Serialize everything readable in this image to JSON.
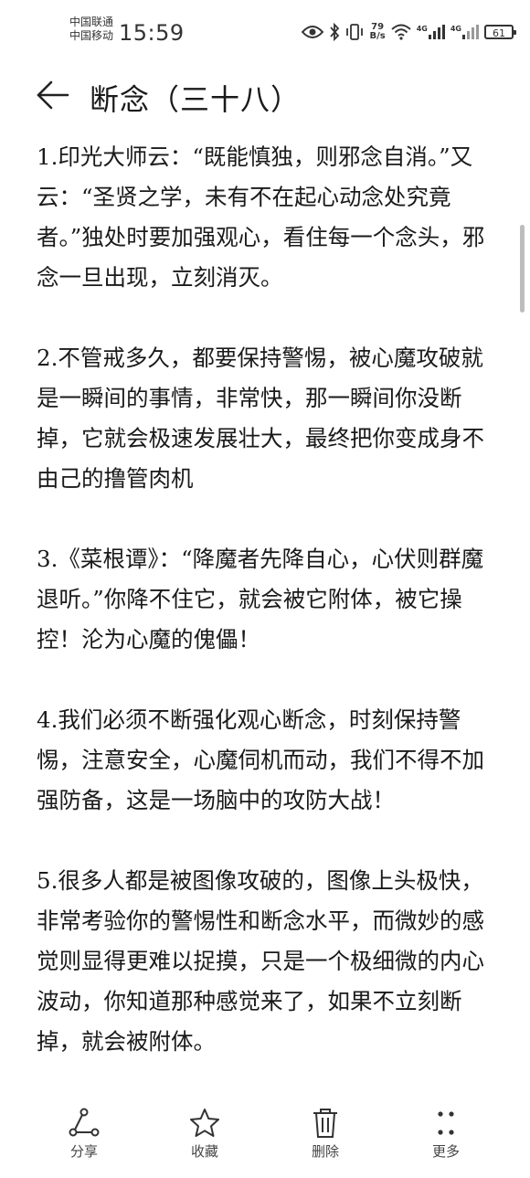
{
  "status_bar": {
    "carrier1": "中国联通",
    "carrier2": "中国移动",
    "time": "15:59",
    "speed_value": "79",
    "speed_unit": "B/s",
    "net1": "4G",
    "net2": "4G",
    "battery": "61"
  },
  "header": {
    "title": "断念（三十八）"
  },
  "content": {
    "paragraphs": [
      "1.印光大师云：“既能慎独，则邪念自消。”又云：“圣贤之学，未有不在起心动念处究竟者。”独处时要加强观心，看住每一个念头，邪念一旦出现，立刻消灭。",
      "2.不管戒多久，都要保持警惕，被心魔攻破就是一瞬间的事情，非常快，那一瞬间你没断掉，它就会极速发展壮大，最终把你变成身不由己的撸管肉机",
      "3.《菜根谭》：“降魔者先降自心，心伏则群魔退听。”你降不住它，就会被它附体，被它操控！沦为心魔的傀儡！",
      "4.我们必须不断强化观心断念，时刻保持警惕，注意安全，心魔伺机而动，我们不得不加强防备，这是一场脑中的攻防大战！",
      "5.很多人都是被图像攻破的，图像上头极快，非常考验你的警惕性和断念水平，而微妙的感觉则显得更难以捉摸，只是一个极细微的内心波动，你知道那种感觉来了，如果不立刻断掉，就会被附体。"
    ]
  },
  "toolbar": {
    "share": "分享",
    "favorite": "收藏",
    "delete": "删除",
    "more": "更多"
  }
}
